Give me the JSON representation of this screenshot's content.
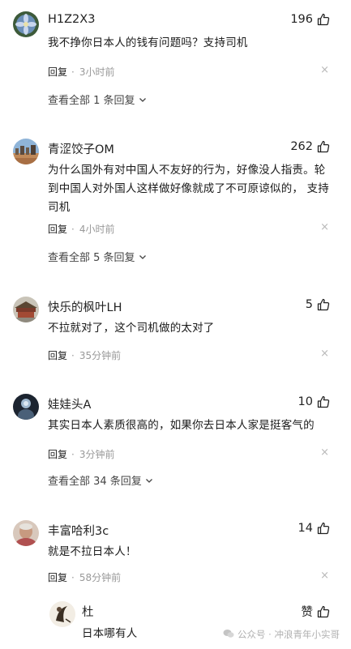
{
  "comments": [
    {
      "username": "H1Z2X3",
      "likes": "196",
      "avatar_icon": "blue-flower-avatar",
      "content": "我不挣你日本人的钱有问题吗？支持司机",
      "reply_label": "回复",
      "time": "3小时前",
      "view_all": "查看全部 1 条回复"
    },
    {
      "username": "青涩饺子OM",
      "likes": "262",
      "avatar_icon": "city-skyline-avatar",
      "content": "为什么国外有对中国人不友好的行为，好像没人指责。轮到中国人对外国人这样做好像就成了不可原谅似的， 支持司机",
      "reply_label": "回复",
      "time": "4小时前",
      "view_all": "查看全部 5 条回复"
    },
    {
      "username": "快乐的枫叶LH",
      "likes": "5",
      "avatar_icon": "palace-avatar",
      "content": "不拉就对了，这个司机做的太对了",
      "reply_label": "回复",
      "time": "35分钟前"
    },
    {
      "username": "娃娃头A",
      "likes": "10",
      "avatar_icon": "dark-figure-avatar",
      "content": "其实日本人素质很高的，如果你去日本人家是挺客气的",
      "reply_label": "回复",
      "time": "3分钟前",
      "view_all": "查看全部 34 条回复"
    },
    {
      "username": "丰富哈利3c",
      "likes": "14",
      "avatar_icon": "elder-portrait-avatar",
      "content": "就是不拉日本人！",
      "reply_label": "回复",
      "time": "58分钟前"
    }
  ],
  "sub_reply": {
    "username": "杜",
    "likes": "赞",
    "avatar_icon": "ink-art-avatar",
    "content": "日本哪有人"
  },
  "watermark": {
    "text": "公众号 · 冲浪青年小实哥"
  },
  "close_glyph": "×",
  "colors": {
    "text": "#1a1a1a",
    "meta_gray": "#999999",
    "close_gray": "#b8b8b8"
  }
}
